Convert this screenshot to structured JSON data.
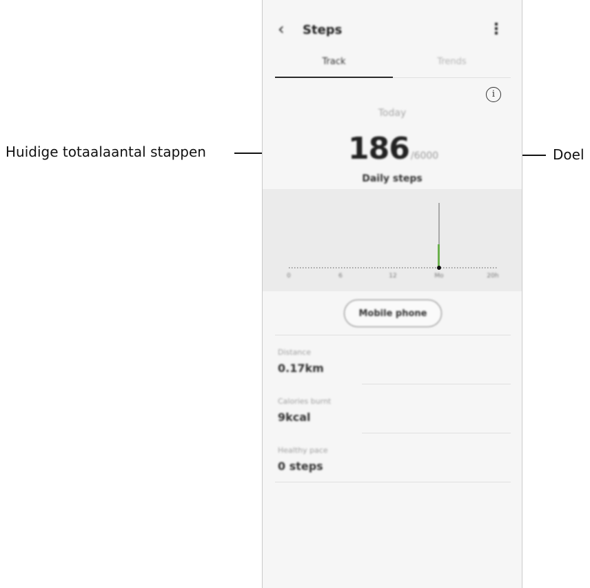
{
  "annotations": {
    "current_total_label": "Huidige totaalaantal stappen",
    "goal_label": "Doel"
  },
  "appbar": {
    "title": "Steps",
    "back_icon": "chevron-left-icon",
    "more_icon": "more-vert-icon"
  },
  "tabs": [
    {
      "label": "Track",
      "active": true
    },
    {
      "label": "Trends",
      "active": false
    }
  ],
  "summary": {
    "period": "Today",
    "steps": "186",
    "goal": "/6000",
    "label": "Daily steps"
  },
  "chart": {
    "x_labels": [
      "0",
      "6",
      "12",
      "Mo",
      "20h"
    ],
    "highlight_color": "#6ab04c"
  },
  "source_button": "Mobile phone",
  "metrics": [
    {
      "label": "Distance",
      "value": "0.17km"
    },
    {
      "label": "Calories burnt",
      "value": "9kcal"
    },
    {
      "label": "Healthy pace",
      "value": "0 steps"
    }
  ]
}
